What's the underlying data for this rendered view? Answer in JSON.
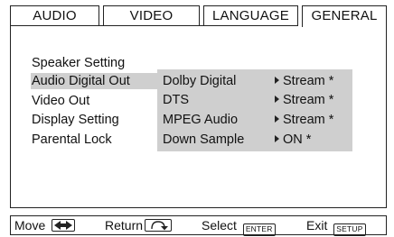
{
  "tabs": [
    {
      "label": "AUDIO",
      "active": false
    },
    {
      "label": "VIDEO",
      "active": false
    },
    {
      "label": "LANGUAGE",
      "active": false
    },
    {
      "label": "GENERAL",
      "active": true
    }
  ],
  "menu": {
    "items": [
      {
        "label": "Speaker Setting"
      },
      {
        "label": "Audio Digital Out",
        "selected": true
      },
      {
        "label": "Video Out"
      },
      {
        "label": "Display Setting"
      },
      {
        "label": "Parental Lock"
      }
    ]
  },
  "submenu": {
    "rows": [
      {
        "label": "Dolby Digital",
        "value": "Stream *"
      },
      {
        "label": "DTS",
        "value": "Stream *"
      },
      {
        "label": "MPEG Audio",
        "value": "Stream *"
      },
      {
        "label": "Down Sample",
        "value": "ON *"
      }
    ]
  },
  "footer": {
    "move_label": "Move",
    "move_icon": "left-right-arrows-icon",
    "return_label": "Return",
    "return_icon": "return-arrow-icon",
    "select_label": "Select",
    "select_key": "ENTER",
    "exit_label": "Exit",
    "exit_key": "SETUP"
  },
  "colors": {
    "highlight": "#cfcfcf",
    "border": "#222222",
    "background": "#ffffff"
  }
}
